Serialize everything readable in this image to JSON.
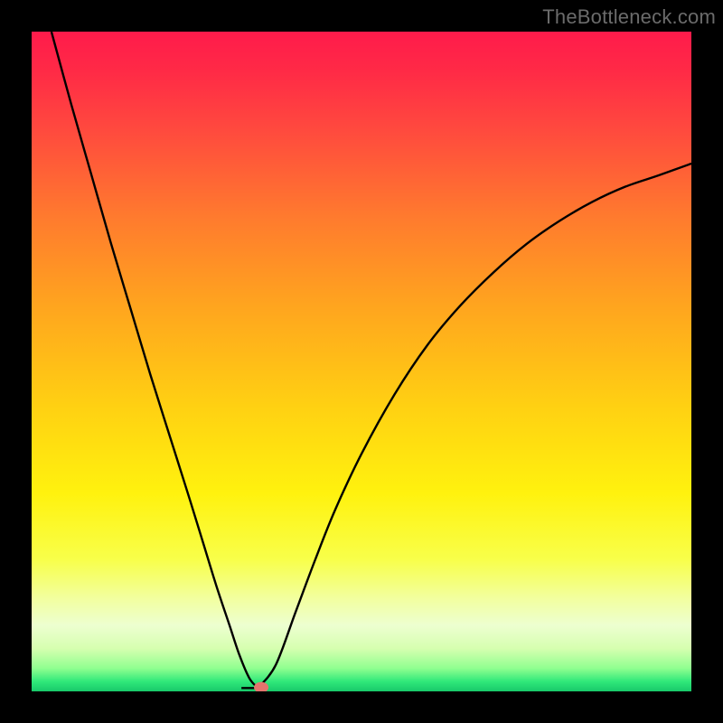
{
  "watermark": "TheBottleneck.com",
  "chart_data": {
    "type": "line",
    "title": "",
    "xlabel": "",
    "ylabel": "",
    "xlim": [
      0,
      100
    ],
    "ylim": [
      0,
      100
    ],
    "grid": false,
    "background_gradient": {
      "stops": [
        {
          "offset": 0.0,
          "color": "#ff1b4b"
        },
        {
          "offset": 0.06,
          "color": "#ff2a46"
        },
        {
          "offset": 0.15,
          "color": "#ff4a3e"
        },
        {
          "offset": 0.28,
          "color": "#ff7a2e"
        },
        {
          "offset": 0.42,
          "color": "#ffa61e"
        },
        {
          "offset": 0.57,
          "color": "#ffd112"
        },
        {
          "offset": 0.7,
          "color": "#fff20e"
        },
        {
          "offset": 0.8,
          "color": "#f8ff4a"
        },
        {
          "offset": 0.86,
          "color": "#f2ffa0"
        },
        {
          "offset": 0.9,
          "color": "#edffd0"
        },
        {
          "offset": 0.935,
          "color": "#d6ffb0"
        },
        {
          "offset": 0.965,
          "color": "#90ff90"
        },
        {
          "offset": 0.985,
          "color": "#30e87a"
        },
        {
          "offset": 1.0,
          "color": "#18c96a"
        }
      ]
    },
    "series": [
      {
        "name": "bottleneck-curve",
        "color": "#000000",
        "x": [
          3.0,
          6.0,
          9.0,
          12.0,
          15.0,
          18.0,
          21.0,
          24.0,
          26.0,
          28.0,
          30.0,
          31.5,
          33.0,
          34.3,
          37.0,
          40.0,
          43.0,
          46.0,
          50.0,
          55.0,
          60.0,
          65.0,
          70.0,
          75.0,
          80.0,
          85.0,
          90.0,
          95.0,
          100.0
        ],
        "values": [
          100.0,
          89.0,
          78.5,
          68.0,
          58.0,
          48.0,
          38.5,
          29.0,
          22.5,
          16.0,
          10.0,
          5.5,
          2.0,
          0.5,
          4.0,
          12.0,
          20.0,
          27.5,
          36.0,
          45.0,
          52.5,
          58.5,
          63.5,
          67.8,
          71.3,
          74.2,
          76.5,
          78.2,
          80.0
        ]
      }
    ],
    "notch": {
      "x_start": 31.8,
      "x_end": 34.3,
      "y": 0.5
    },
    "marker": {
      "x": 34.8,
      "y": 0.6,
      "color": "#e4746d"
    }
  }
}
